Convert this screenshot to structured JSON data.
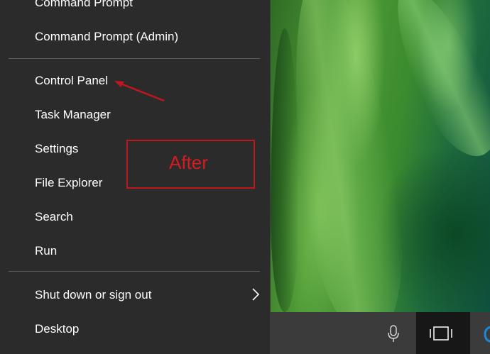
{
  "context_menu": {
    "items": [
      {
        "label": "Command Prompt"
      },
      {
        "label": "Command Prompt (Admin)"
      },
      {
        "label": "Control Panel"
      },
      {
        "label": "Task Manager"
      },
      {
        "label": "Settings"
      },
      {
        "label": "File Explorer"
      },
      {
        "label": "Search"
      },
      {
        "label": "Run"
      },
      {
        "label": "Shut down or sign out"
      },
      {
        "label": "Desktop"
      }
    ],
    "submenu_icon": "chevron-right-icon"
  },
  "annotation": {
    "label": "After",
    "color": "#c0171e"
  },
  "taskbar": {
    "icons": [
      "microphone-icon",
      "task-view-icon",
      "edge-icon"
    ]
  },
  "colors": {
    "menu_background": "#2b2b2b",
    "menu_text": "#ffffff",
    "taskbar": "#3b3b3b"
  }
}
